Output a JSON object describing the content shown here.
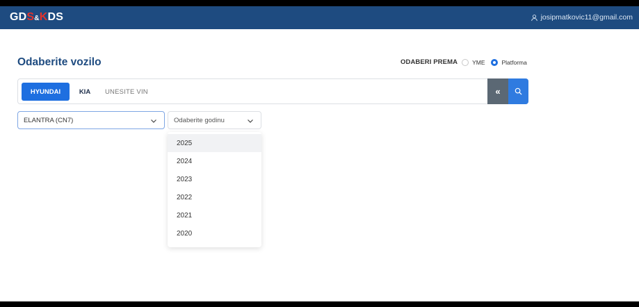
{
  "header": {
    "logo": {
      "part1": "GD",
      "part2": "S",
      "amp": "&",
      "part3": "K",
      "part4": "DS"
    },
    "user_email": "josipmatkovic11@gmail.com"
  },
  "page": {
    "title": "Odaberite vozilo"
  },
  "filter": {
    "label": "ODABERI PREMA",
    "options": [
      {
        "label": "YME",
        "selected": false
      },
      {
        "label": "Platforma",
        "selected": true
      }
    ]
  },
  "search": {
    "brands": [
      {
        "label": "HYUNDAI",
        "active": true
      },
      {
        "label": "KIA",
        "active": false
      }
    ],
    "vin_placeholder": "UNESITE VIN",
    "vin_value": "",
    "collapse_label": "«"
  },
  "model_select": {
    "value": "ELANTRA (CN7)"
  },
  "year_select": {
    "placeholder": "Odaberite godinu",
    "options": [
      "2025",
      "2024",
      "2023",
      "2022",
      "2021",
      "2020"
    ],
    "highlighted_index": 0
  },
  "colors": {
    "header_bg": "#1e4b80",
    "accent": "#1e6fe0",
    "logo_red": "#e4322b",
    "collapse_bg": "#5b6874"
  }
}
